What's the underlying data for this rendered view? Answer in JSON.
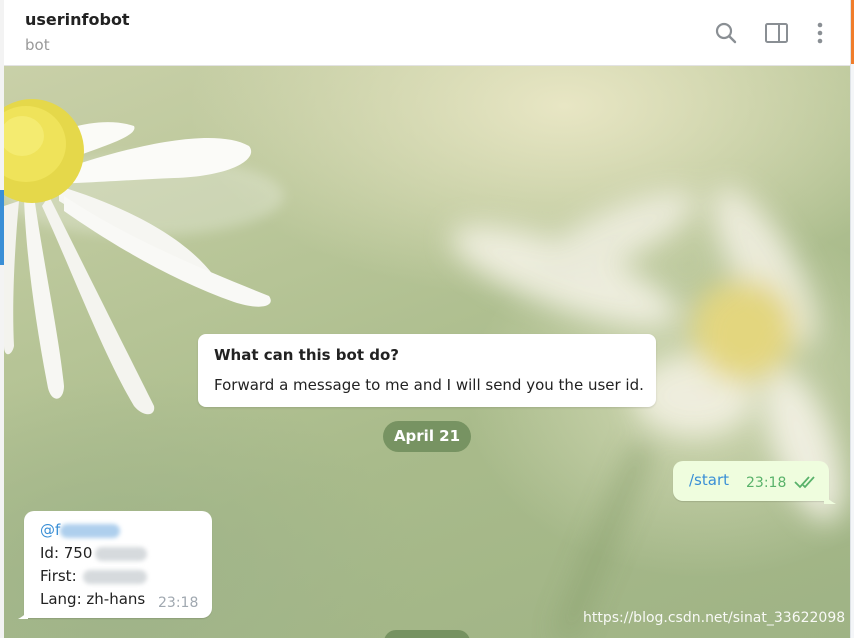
{
  "header": {
    "title": "userinfobot",
    "subtitle": "bot",
    "buttons": [
      {
        "name": "search-icon"
      },
      {
        "name": "sidebar-toggle-icon"
      },
      {
        "name": "more-vertical-icon"
      }
    ]
  },
  "messages": {
    "bot_intro": {
      "title": "What can this bot do?",
      "text": "Forward a message to me and I will send you the user id."
    },
    "date_separator": "April 21",
    "outgoing": {
      "text": "/start",
      "time": "23:18",
      "status_icon": "double-check-icon"
    },
    "incoming": {
      "mention_prefix": "@f",
      "id_label": "Id: 750",
      "first_label": "First:",
      "lang_label": "Lang: zh-hans",
      "time": "23:18"
    }
  },
  "watermark": "https://blog.csdn.net/sinat_33622098",
  "colors": {
    "accent": "#3a8fd6",
    "outgoing_bubble": "#effdde",
    "date_pill": "#6e8c5a",
    "read_ticks": "#59b26a"
  }
}
